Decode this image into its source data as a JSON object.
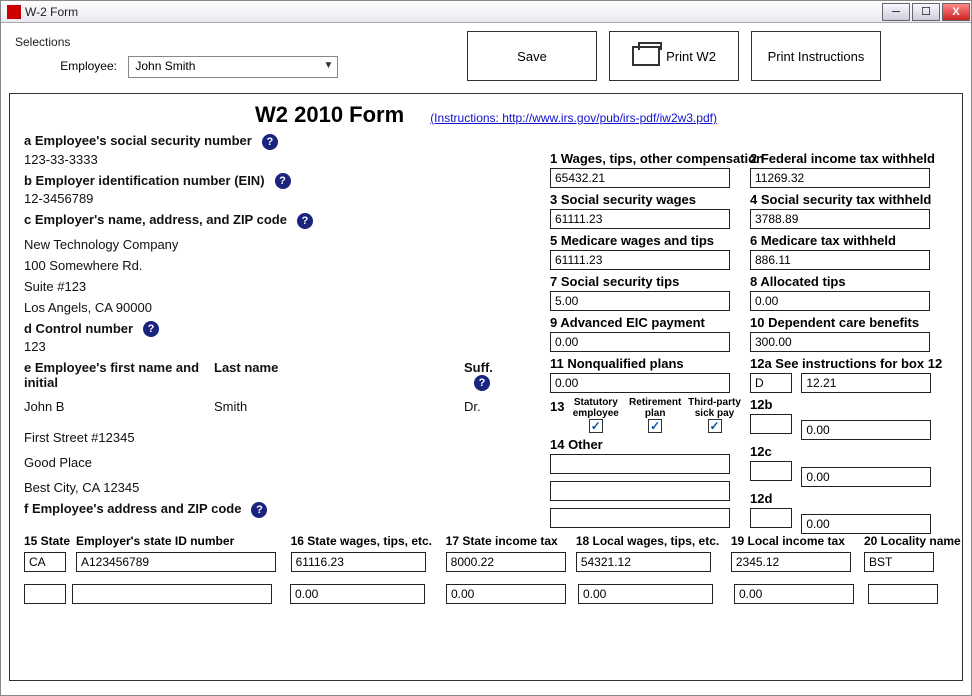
{
  "window": {
    "title": "W-2 Form"
  },
  "toolbar": {
    "selections_label": "Selections",
    "employee_label": "Employee:",
    "employee_value": "John Smith",
    "save_label": "Save",
    "print_w2_label": "Print W2",
    "print_instructions_label": "Print Instructions"
  },
  "form": {
    "title": "W2 2010 Form",
    "instructions_link": "(Instructions: http://www.irs.gov/pub/irs-pdf/iw2w3.pdf)",
    "a_label": "a Employee's social security number",
    "a_value": "123-33-3333",
    "b_label": "b Employer identification number (EIN)",
    "b_value": "12-3456789",
    "c_label": "c Employer's name, address, and ZIP code",
    "c_name": "New Technology Company",
    "c_addr1": "100 Somewhere Rd.",
    "c_addr2": "Suite #123",
    "c_city": "Los Angels, CA 90000",
    "d_label": "d Control number",
    "d_value": "123",
    "e_first_label": "e Employee's first name and initial",
    "e_last_label": "Last name",
    "e_suff_label": "Suff.",
    "e_first": "John B",
    "e_last": "Smith",
    "e_suff": "Dr.",
    "e_addr1": "First Street #12345",
    "e_addr2": "Good Place",
    "e_city": "Best City, CA 12345",
    "f_label": "f Employee's address and ZIP code",
    "box1_label": "1 Wages, tips, other compensation",
    "box1": "65432.21",
    "box2_label": "2 Federal income tax withheld",
    "box2": "11269.32",
    "box3_label": "3 Social security wages",
    "box3": "61111.23",
    "box4_label": "4 Social security tax withheld",
    "box4": "3788.89",
    "box5_label": "5 Medicare wages and tips",
    "box5": "61111.23",
    "box6_label": "6 Medicare tax withheld",
    "box6": "886.11",
    "box7_label": "7 Social security tips",
    "box7": "5.00",
    "box8_label": "8 Allocated tips",
    "box8": "0.00",
    "box9_label": "9 Advanced EIC payment",
    "box9": "0.00",
    "box10_label": "10 Dependent care benefits",
    "box10": "300.00",
    "box11_label": "11 Nonqualified plans",
    "box11": "0.00",
    "box12a_label": "12a See instructions for box 12",
    "box12a_code": "D",
    "box12a_val": "12.21",
    "box12b_label": "12b",
    "box12b_code": "",
    "box12b_val": "0.00",
    "box12c_label": "12c",
    "box12c_code": "",
    "box12c_val": "0.00",
    "box12d_label": "12d",
    "box12d_code": "",
    "box12d_val": "0.00",
    "box13_label": "13",
    "box13_stat": "Statutory employee",
    "box13_ret": "Retirement plan",
    "box13_sick": "Third-party sick pay",
    "box13_stat_chk": "✓",
    "box13_ret_chk": "✓",
    "box13_sick_chk": "✓",
    "box14_label": "14 Other",
    "box15_label": "15 State",
    "box15_empid_label": "Employer's state ID number",
    "box16_label": "16 State wages, tips, etc.",
    "box17_label": "17 State income tax",
    "box18_label": "18 Local wages, tips, etc.",
    "box19_label": "19 Local income tax",
    "box20_label": "20 Locality name",
    "row1": {
      "state": "CA",
      "empid": "A123456789",
      "b16": "61116.23",
      "b17": "8000.22",
      "b18": "54321.12",
      "b19": "2345.12",
      "b20": "BST"
    },
    "row2": {
      "state": "",
      "empid": "",
      "b16": "0.00",
      "b17": "0.00",
      "b18": "0.00",
      "b19": "0.00",
      "b20": ""
    }
  }
}
